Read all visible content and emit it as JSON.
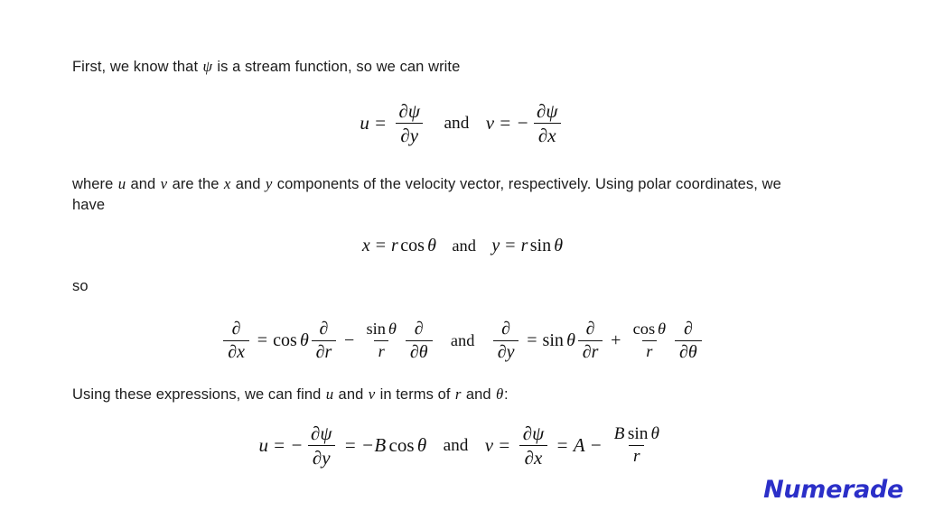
{
  "document": {
    "title": "Stream function solution",
    "background_color": "#ffffff",
    "text_color": "#1c1c1c"
  },
  "paragraphs": {
    "p1_a": "First, we know that ",
    "p1_psi": "ψ",
    "p1_b": " is a stream function, so we can write",
    "p2_a": "where ",
    "p2_u": "u",
    "p2_b": " and ",
    "p2_v": "v",
    "p2_c": " are the ",
    "p2_x": "x",
    "p2_d": " and ",
    "p2_y": "y",
    "p2_e": " components of the velocity vector, respectively. Using polar coordinates, we have",
    "p3": "so",
    "p4_a": "Using these expressions, we can find ",
    "p4_u": "u",
    "p4_b": " and ",
    "p4_v": "v",
    "p4_c": " in terms of ",
    "p4_r": "r",
    "p4_d": " and ",
    "p4_theta": "θ",
    "p4_e": ":"
  },
  "equations": {
    "eq1": {
      "id": "velocity-from-stream-function",
      "latex": "u = \\frac{\\partial \\psi}{\\partial y} \\quad \\text{and} \\quad v = -\\frac{\\partial \\psi}{\\partial x}",
      "left": {
        "lhs": "u",
        "equals": "=",
        "num": "∂ψ",
        "den": "∂y"
      },
      "conjunction": "and",
      "right": {
        "lhs": "v",
        "equals": "=",
        "sign": "−",
        "num": "∂ψ",
        "den": "∂x"
      }
    },
    "eq2": {
      "id": "polar-coordinate-definitions",
      "latex": "x = r\\cos\\theta \\quad \\text{and} \\quad y = r\\sin\\theta",
      "left": {
        "lhs": "x",
        "equals": "=",
        "r": "r",
        "fn": "cos",
        "arg": "θ"
      },
      "conjunction": "and",
      "right": {
        "lhs": "y",
        "equals": "=",
        "r": "r",
        "fn": "sin",
        "arg": "θ"
      }
    },
    "eq3": {
      "id": "partial-derivative-chain-rule",
      "latex": "\\frac{\\partial}{\\partial x} = \\cos\\theta\\frac{\\partial}{\\partial r} - \\frac{\\sin\\theta}{r}\\frac{\\partial}{\\partial\\theta} \\quad \\text{and} \\quad \\frac{\\partial}{\\partial y} = \\sin\\theta\\frac{\\partial}{\\partial r} + \\frac{\\cos\\theta}{r}\\frac{\\partial}{\\partial\\theta}",
      "left": {
        "lhs_num": "∂",
        "lhs_den": "∂x",
        "equals": "=",
        "fn1": "cos",
        "arg1": "θ",
        "t1_num": "∂",
        "t1_den": "∂r",
        "operator": "−",
        "t2_num_fn": "sin",
        "t2_num_arg": "θ",
        "t2_den": "r",
        "t3_num": "∂",
        "t3_den": "∂θ"
      },
      "conjunction": "and",
      "right": {
        "lhs_num": "∂",
        "lhs_den": "∂y",
        "equals": "=",
        "fn1": "sin",
        "arg1": "θ",
        "t1_num": "∂",
        "t1_den": "∂r",
        "operator": "+",
        "t2_num_fn": "cos",
        "t2_num_arg": "θ",
        "t2_den": "r",
        "t3_num": "∂",
        "t3_den": "∂θ"
      }
    },
    "eq4": {
      "id": "velocity-components-in-polar",
      "latex": "u = -\\frac{\\partial\\psi}{\\partial y} = -B\\cos\\theta \\quad \\text{and} \\quad v = \\frac{\\partial\\psi}{\\partial x} = A - \\frac{B\\sin\\theta}{r}",
      "left": {
        "lhs": "u",
        "equals1": "=",
        "sign": "−",
        "num": "∂ψ",
        "den": "∂y",
        "equals2": "=",
        "result_sign": "−",
        "result_coeff": "B",
        "result_fn": "cos",
        "result_arg": "θ"
      },
      "conjunction": "and",
      "right": {
        "lhs": "v",
        "equals1": "=",
        "num": "∂ψ",
        "den": "∂x",
        "equals2": "=",
        "term_a": "A",
        "operator": "−",
        "frac_num_coeff": "B",
        "frac_num_fn": "sin",
        "frac_num_arg": "θ",
        "frac_den": "r"
      }
    }
  },
  "branding": {
    "logo_text": "Numerade",
    "logo_color": "#2b2fc8"
  }
}
